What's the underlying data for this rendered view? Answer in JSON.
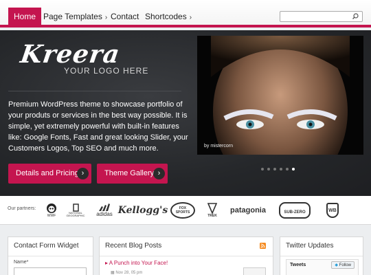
{
  "nav": {
    "items": [
      {
        "label": "Home"
      },
      {
        "label": "Page Templates"
      },
      {
        "label": "Contact"
      },
      {
        "label": "Shortcodes"
      }
    ]
  },
  "hero": {
    "logo": "Kreera",
    "logo_sub": "YOUR LOGO HERE",
    "description": "Premium WordPress theme to showcase portfolio of your produts or services in the best way possible. It is simple, yet extremely powerful with built-in features like: Google Fonts, Fast and great looking Slider, your Customers Logos, Top SEO and much more.",
    "buttons": [
      {
        "label": "Details and Pricing"
      },
      {
        "label": "Theme Gallery"
      }
    ],
    "slide_caption": "by mistercorn",
    "slide_count": 6,
    "active_slide": 6
  },
  "partners": {
    "label": "Our partners:",
    "logos": [
      "WWF",
      "NATIONAL GEOGRAPHIC",
      "adidas",
      "Kellogg's",
      "FOX SPORTS",
      "TREK",
      "patagonia",
      "SUB-ZERO",
      "WB"
    ]
  },
  "widgets": {
    "contact": {
      "title": "Contact Form Widget",
      "name_label": "Name*"
    },
    "blog": {
      "title": "Recent Blog Posts",
      "post_title": "A Punch into Your Face!",
      "post_date": "Nov 28, 05 pm"
    },
    "twitter": {
      "title": "Twitter Updates",
      "tweets_label": "Tweets",
      "follow_label": "Follow"
    }
  },
  "colors": {
    "accent": "#c4154f",
    "dark": "#25272a"
  }
}
